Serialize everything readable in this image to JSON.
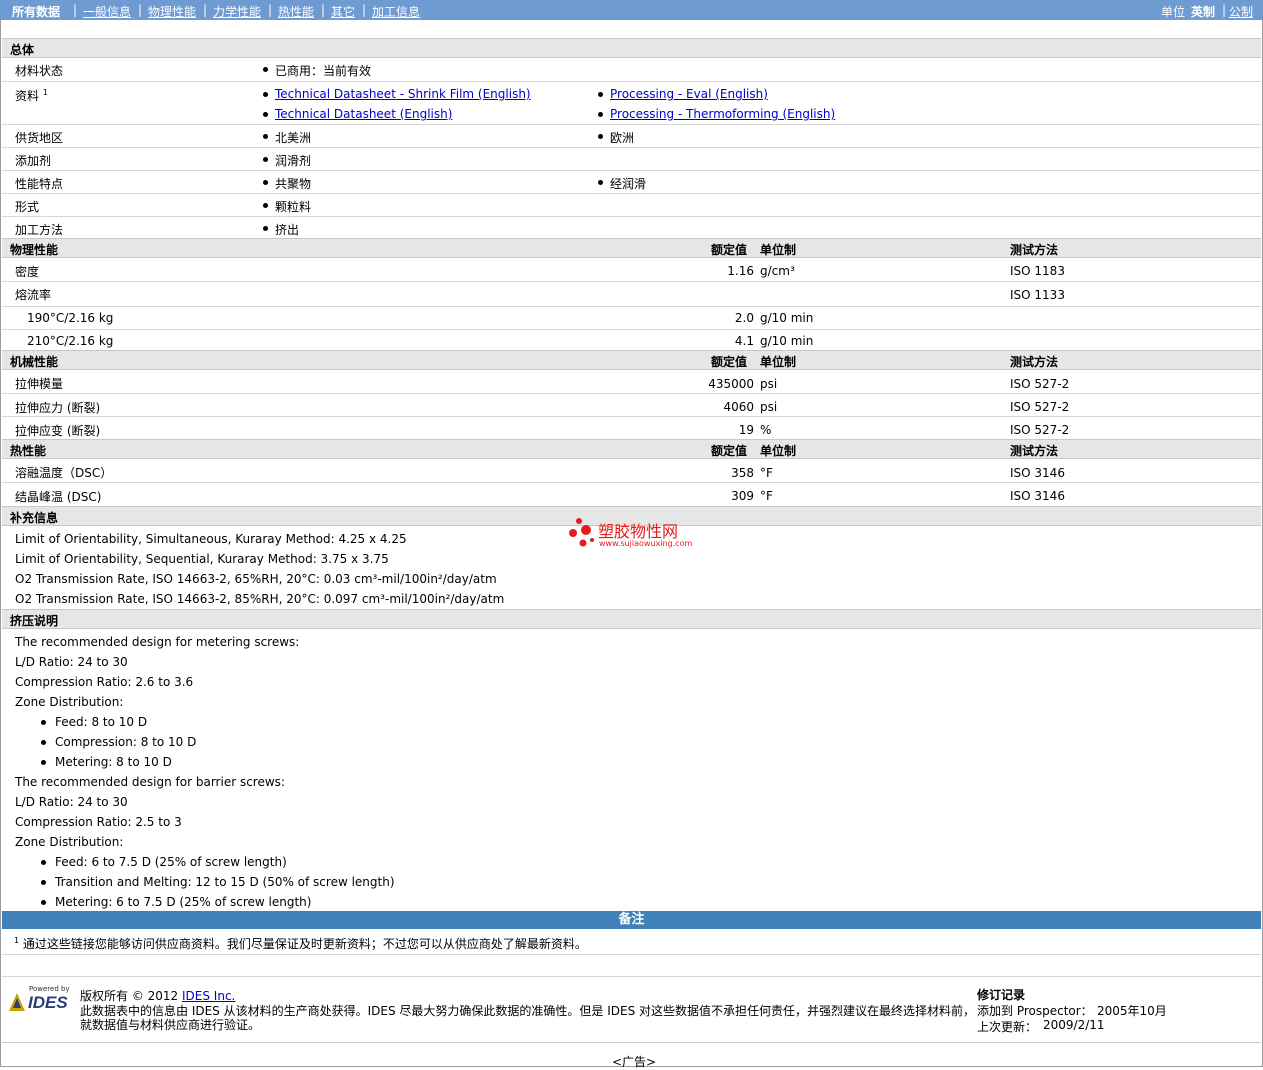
{
  "nav": {
    "items": [
      "所有数据",
      "一般信息",
      "物理性能",
      "力学性能",
      "热性能",
      "其它",
      "加工信息"
    ],
    "unit_label": "单位",
    "unit_english": "英制",
    "unit_metric": "公制"
  },
  "general": {
    "title": "总体",
    "status_label": "材料状态",
    "status_value": "已商用：当前有效",
    "docs_label": "资料",
    "docs_sup": "1",
    "docs": [
      "Technical Datasheet - Shrink Film (English)",
      "Processing - Eval (English)",
      "Technical Datasheet (English)",
      "Processing - Thermoforming (English)"
    ],
    "region_label": "供货地区",
    "regions": [
      "北美洲",
      "欧洲"
    ],
    "additive_label": "添加剂",
    "additive": "润滑剂",
    "features_label": "性能特点",
    "features": [
      "共聚物",
      "经润滑"
    ],
    "form_label": "形式",
    "form": "颗粒料",
    "process_label": "加工方法",
    "process": "挤出"
  },
  "headers": {
    "nominal": "额定值",
    "unit": "单位制",
    "method": "测试方法"
  },
  "physical": {
    "title": "物理性能",
    "rows": [
      {
        "name": "密度",
        "value": "1.16",
        "unit": "g/cm³",
        "method": "ISO 1183"
      },
      {
        "name": "熔流率",
        "value": "",
        "unit": "",
        "method": "ISO 1133"
      },
      {
        "name": "190°C/2.16 kg",
        "value": "2.0",
        "unit": "g/10 min",
        "method": ""
      },
      {
        "name": "210°C/2.16 kg",
        "value": "4.1",
        "unit": "g/10 min",
        "method": ""
      }
    ]
  },
  "mechanical": {
    "title": "机械性能",
    "rows": [
      {
        "name": "拉伸模量",
        "value": "435000",
        "unit": "psi",
        "method": "ISO 527-2"
      },
      {
        "name": "拉伸应力 (断裂)",
        "value": "4060",
        "unit": "psi",
        "method": "ISO 527-2"
      },
      {
        "name": "拉伸应变 (断裂)",
        "value": "19",
        "unit": "%",
        "method": "ISO 527-2"
      }
    ]
  },
  "thermal": {
    "title": "热性能",
    "rows": [
      {
        "name": "溶融温度（DSC）",
        "value": "358",
        "unit": "°F",
        "method": "ISO 3146"
      },
      {
        "name": "结晶峰温 (DSC)",
        "value": "309",
        "unit": "°F",
        "method": "ISO 3146"
      }
    ]
  },
  "supplement": {
    "title": "补充信息",
    "lines": [
      "Limit of Orientability, Simultaneous, Kuraray Method: 4.25 x 4.25",
      "Limit of Orientability, Sequential, Kuraray Method: 3.75 x 3.75",
      "O2 Transmission Rate, ISO 14663-2, 65%RH, 20°C: 0.03 cm³-mil/100in²/day/atm",
      "O2 Transmission Rate, ISO 14663-2, 85%RH, 20°C: 0.097 cm³-mil/100in²/day/atm"
    ]
  },
  "watermark": {
    "name": "塑胶物性网",
    "url": "www.sujiaowuxing.com"
  },
  "extrusion": {
    "title": "挤压说明",
    "lines": [
      {
        "t": "The recommended design for metering screws:",
        "b": false
      },
      {
        "t": "L/D Ratio: 24 to 30",
        "b": false
      },
      {
        "t": "Compression Ratio: 2.6 to 3.6",
        "b": false
      },
      {
        "t": "Zone Distribution:",
        "b": false
      },
      {
        "t": "Feed: 8 to 10 D",
        "b": true
      },
      {
        "t": "Compression: 8 to 10 D",
        "b": true
      },
      {
        "t": "Metering: 8 to 10 D",
        "b": true
      },
      {
        "t": "The recommended design for barrier screws:",
        "b": false
      },
      {
        "t": "L/D Ratio: 24 to 30",
        "b": false
      },
      {
        "t": "Compression Ratio: 2.5 to 3",
        "b": false
      },
      {
        "t": "Zone Distribution:",
        "b": false
      },
      {
        "t": "Feed: 6 to 7.5 D (25% of screw length)",
        "b": true
      },
      {
        "t": "Transition and Melting: 12 to 15 D (50% of screw length)",
        "b": true
      },
      {
        "t": "Metering: 6 to 7.5 D (25% of screw length)",
        "b": true
      }
    ]
  },
  "notes": {
    "title": "备注",
    "sup": "1",
    "text": "通过这些链接您能够访问供应商资料。我们尽量保证及时更新资料；不过您可以从供应商处了解最新资料。"
  },
  "footer": {
    "powered": "Powered by",
    "logo": "IDES",
    "copyright_prefix": "版权所有 © 2012",
    "company_link": "IDES Inc.",
    "disclaimer_1": "此数据表中的信息由 IDES 从该材料的生产商处获得。IDES 尽最大努力确保此数据的准确性。但是 IDES 对这些数据值不承担任何责任，并强烈建议在最终选择材料前，",
    "disclaimer_2": "就数据值与材料供应商进行验证。",
    "rev_title": "修订记录",
    "added_label": "添加到 Prospector：",
    "added_date": "2005年10月",
    "updated_label": "上次更新：",
    "updated_date": "2009/2/11",
    "ad": "<广告>"
  }
}
